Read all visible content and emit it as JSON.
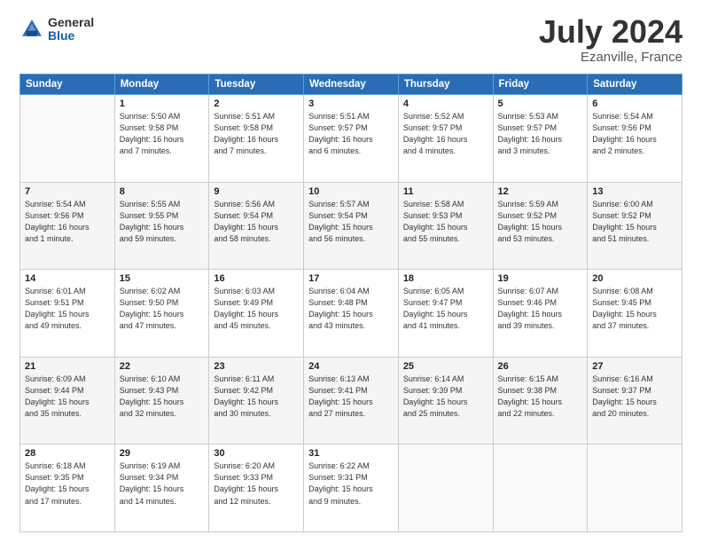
{
  "header": {
    "logo_general": "General",
    "logo_blue": "Blue",
    "title": "July 2024",
    "location": "Ezanville, France"
  },
  "weekdays": [
    "Sunday",
    "Monday",
    "Tuesday",
    "Wednesday",
    "Thursday",
    "Friday",
    "Saturday"
  ],
  "weeks": [
    [
      {
        "day": "",
        "info": ""
      },
      {
        "day": "1",
        "info": "Sunrise: 5:50 AM\nSunset: 9:58 PM\nDaylight: 16 hours\nand 7 minutes."
      },
      {
        "day": "2",
        "info": "Sunrise: 5:51 AM\nSunset: 9:58 PM\nDaylight: 16 hours\nand 7 minutes."
      },
      {
        "day": "3",
        "info": "Sunrise: 5:51 AM\nSunset: 9:57 PM\nDaylight: 16 hours\nand 6 minutes."
      },
      {
        "day": "4",
        "info": "Sunrise: 5:52 AM\nSunset: 9:57 PM\nDaylight: 16 hours\nand 4 minutes."
      },
      {
        "day": "5",
        "info": "Sunrise: 5:53 AM\nSunset: 9:57 PM\nDaylight: 16 hours\nand 3 minutes."
      },
      {
        "day": "6",
        "info": "Sunrise: 5:54 AM\nSunset: 9:56 PM\nDaylight: 16 hours\nand 2 minutes."
      }
    ],
    [
      {
        "day": "7",
        "info": "Sunrise: 5:54 AM\nSunset: 9:56 PM\nDaylight: 16 hours\nand 1 minute."
      },
      {
        "day": "8",
        "info": "Sunrise: 5:55 AM\nSunset: 9:55 PM\nDaylight: 15 hours\nand 59 minutes."
      },
      {
        "day": "9",
        "info": "Sunrise: 5:56 AM\nSunset: 9:54 PM\nDaylight: 15 hours\nand 58 minutes."
      },
      {
        "day": "10",
        "info": "Sunrise: 5:57 AM\nSunset: 9:54 PM\nDaylight: 15 hours\nand 56 minutes."
      },
      {
        "day": "11",
        "info": "Sunrise: 5:58 AM\nSunset: 9:53 PM\nDaylight: 15 hours\nand 55 minutes."
      },
      {
        "day": "12",
        "info": "Sunrise: 5:59 AM\nSunset: 9:52 PM\nDaylight: 15 hours\nand 53 minutes."
      },
      {
        "day": "13",
        "info": "Sunrise: 6:00 AM\nSunset: 9:52 PM\nDaylight: 15 hours\nand 51 minutes."
      }
    ],
    [
      {
        "day": "14",
        "info": "Sunrise: 6:01 AM\nSunset: 9:51 PM\nDaylight: 15 hours\nand 49 minutes."
      },
      {
        "day": "15",
        "info": "Sunrise: 6:02 AM\nSunset: 9:50 PM\nDaylight: 15 hours\nand 47 minutes."
      },
      {
        "day": "16",
        "info": "Sunrise: 6:03 AM\nSunset: 9:49 PM\nDaylight: 15 hours\nand 45 minutes."
      },
      {
        "day": "17",
        "info": "Sunrise: 6:04 AM\nSunset: 9:48 PM\nDaylight: 15 hours\nand 43 minutes."
      },
      {
        "day": "18",
        "info": "Sunrise: 6:05 AM\nSunset: 9:47 PM\nDaylight: 15 hours\nand 41 minutes."
      },
      {
        "day": "19",
        "info": "Sunrise: 6:07 AM\nSunset: 9:46 PM\nDaylight: 15 hours\nand 39 minutes."
      },
      {
        "day": "20",
        "info": "Sunrise: 6:08 AM\nSunset: 9:45 PM\nDaylight: 15 hours\nand 37 minutes."
      }
    ],
    [
      {
        "day": "21",
        "info": "Sunrise: 6:09 AM\nSunset: 9:44 PM\nDaylight: 15 hours\nand 35 minutes."
      },
      {
        "day": "22",
        "info": "Sunrise: 6:10 AM\nSunset: 9:43 PM\nDaylight: 15 hours\nand 32 minutes."
      },
      {
        "day": "23",
        "info": "Sunrise: 6:11 AM\nSunset: 9:42 PM\nDaylight: 15 hours\nand 30 minutes."
      },
      {
        "day": "24",
        "info": "Sunrise: 6:13 AM\nSunset: 9:41 PM\nDaylight: 15 hours\nand 27 minutes."
      },
      {
        "day": "25",
        "info": "Sunrise: 6:14 AM\nSunset: 9:39 PM\nDaylight: 15 hours\nand 25 minutes."
      },
      {
        "day": "26",
        "info": "Sunrise: 6:15 AM\nSunset: 9:38 PM\nDaylight: 15 hours\nand 22 minutes."
      },
      {
        "day": "27",
        "info": "Sunrise: 6:16 AM\nSunset: 9:37 PM\nDaylight: 15 hours\nand 20 minutes."
      }
    ],
    [
      {
        "day": "28",
        "info": "Sunrise: 6:18 AM\nSunset: 9:35 PM\nDaylight: 15 hours\nand 17 minutes."
      },
      {
        "day": "29",
        "info": "Sunrise: 6:19 AM\nSunset: 9:34 PM\nDaylight: 15 hours\nand 14 minutes."
      },
      {
        "day": "30",
        "info": "Sunrise: 6:20 AM\nSunset: 9:33 PM\nDaylight: 15 hours\nand 12 minutes."
      },
      {
        "day": "31",
        "info": "Sunrise: 6:22 AM\nSunset: 9:31 PM\nDaylight: 15 hours\nand 9 minutes."
      },
      {
        "day": "",
        "info": ""
      },
      {
        "day": "",
        "info": ""
      },
      {
        "day": "",
        "info": ""
      }
    ]
  ]
}
